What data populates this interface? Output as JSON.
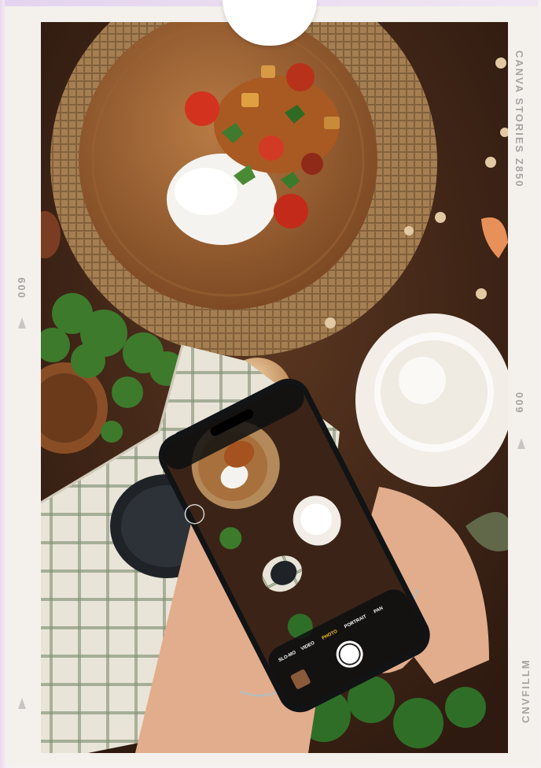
{
  "frame": {
    "left_bottom_label": "CNVFILLM",
    "left_top_label": "009",
    "right_top_label": "CANVA STORIES Z850",
    "right_mid_label": "009"
  },
  "phone_camera": {
    "modes": [
      "SLO-MO",
      "VIDEO",
      "PHOTO",
      "PORTRAIT",
      "PAN"
    ],
    "active_mode": "PHOTO"
  },
  "colors": {
    "table": "#3b2417",
    "frame": "#f4f0ec",
    "label": "#a7a3a0",
    "active_mode": "#f5c518"
  }
}
